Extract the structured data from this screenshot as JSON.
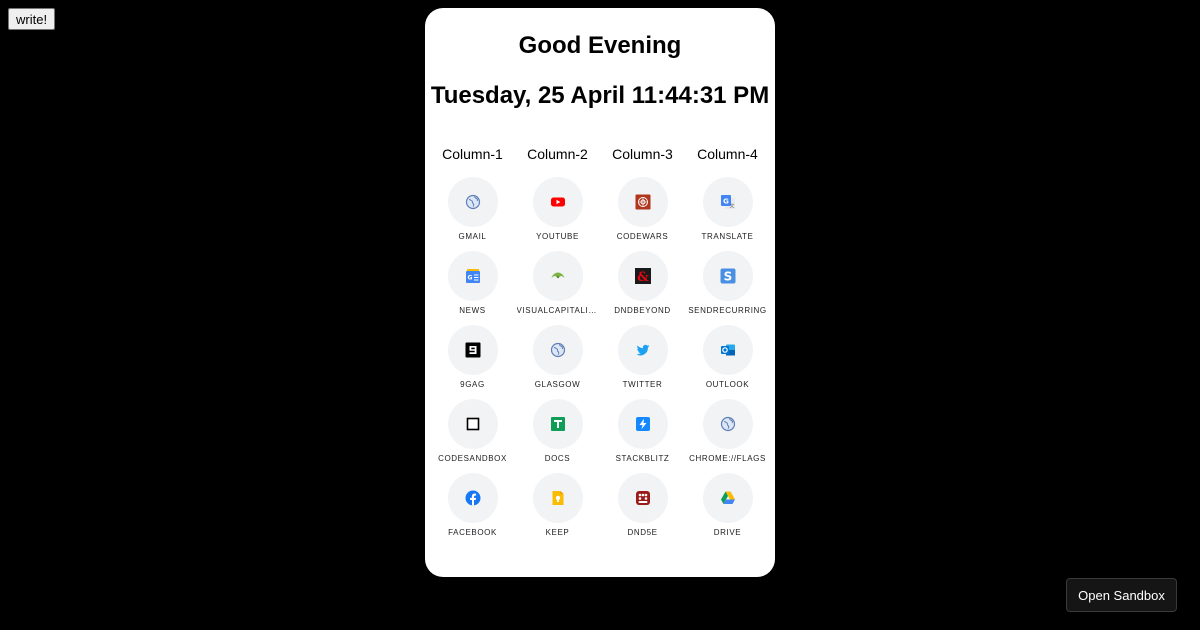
{
  "write_button": {
    "label": "write!"
  },
  "card": {
    "greeting": "Good Evening",
    "datetime": "Tuesday, 25 April 11:44:31 PM",
    "columns": [
      "Column-1",
      "Column-2",
      "Column-3",
      "Column-4"
    ],
    "shortcuts": [
      {
        "label": "GMAIL",
        "icon": "globe-icon"
      },
      {
        "label": "YOUTUBE",
        "icon": "youtube-icon"
      },
      {
        "label": "CODEWARS",
        "icon": "codewars-icon"
      },
      {
        "label": "TRANSLATE",
        "icon": "translate-icon"
      },
      {
        "label": "NEWS",
        "icon": "news-icon"
      },
      {
        "label": "VISUALCAPITALIST",
        "icon": "visualcapitalist-icon"
      },
      {
        "label": "DNDBEYOND",
        "icon": "dndbeyond-icon"
      },
      {
        "label": "SENDRECURRING",
        "icon": "sendrecurring-icon"
      },
      {
        "label": "9GAG",
        "icon": "9gag-icon"
      },
      {
        "label": "GLASGOW",
        "icon": "globe-icon"
      },
      {
        "label": "TWITTER",
        "icon": "twitter-icon"
      },
      {
        "label": "OUTLOOK",
        "icon": "outlook-icon"
      },
      {
        "label": "CODESANDBOX",
        "icon": "codesandbox-icon"
      },
      {
        "label": "DOCS",
        "icon": "docs-icon"
      },
      {
        "label": "STACKBLITZ",
        "icon": "stackblitz-icon"
      },
      {
        "label": "CHROME://FLAGS",
        "icon": "globe-icon"
      },
      {
        "label": "FACEBOOK",
        "icon": "facebook-icon"
      },
      {
        "label": "KEEP",
        "icon": "keep-icon"
      },
      {
        "label": "DND5E",
        "icon": "dnd5e-icon"
      },
      {
        "label": "DRIVE",
        "icon": "drive-icon"
      }
    ]
  },
  "sandbox_button": {
    "label": "Open Sandbox"
  }
}
